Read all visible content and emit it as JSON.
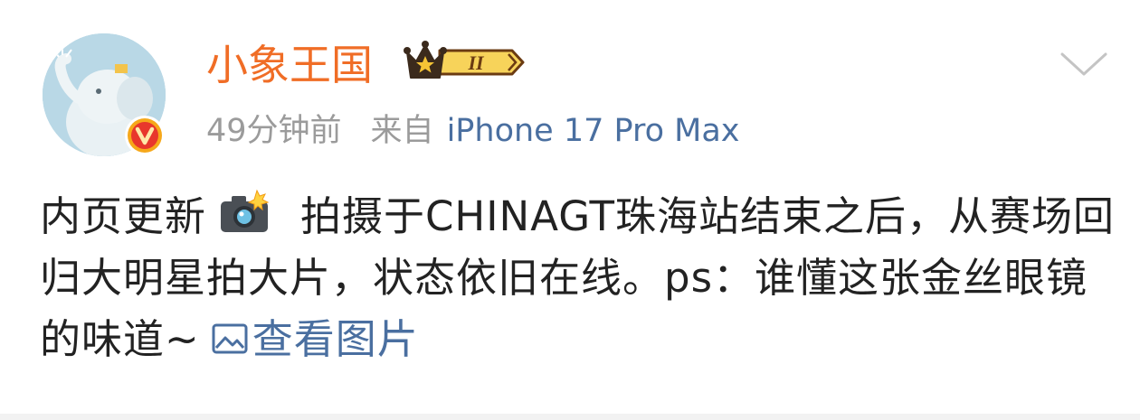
{
  "post": {
    "username": "小象王国",
    "vip_level": "II",
    "time": "49分钟前",
    "from_label": "来自",
    "device": "iPhone 17 Pro Max",
    "text_before_emoji": "内页更新",
    "text_main": "拍摄于CHINAGT珠海站结束之后，从赛场回归大明星拍大片，状态依旧在线。ps：谁懂这张金丝眼镜的味道~",
    "view_image_label": "查看图片"
  },
  "icons": {
    "avatar": "elephant-avatar",
    "verified": "verified-v-icon",
    "vip": "crown-vip-icon",
    "more": "chevron-down-icon",
    "emoji": "camera-flash-icon",
    "image": "image-icon"
  },
  "colors": {
    "username": "#f06d26",
    "link": "#4a6fa0",
    "meta": "#9b9b9b",
    "text": "#222222"
  }
}
